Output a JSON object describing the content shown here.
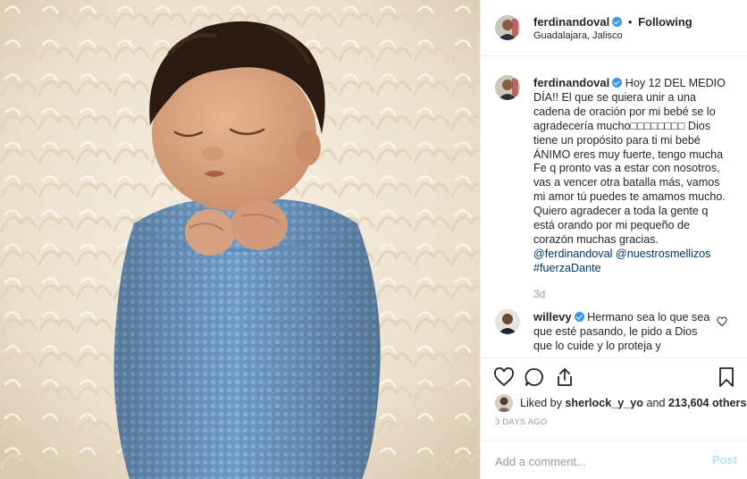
{
  "post": {
    "author": "ferdinandoval",
    "follow_status": "Following",
    "separator": "•",
    "location": "Guadalajara, Jalisco"
  },
  "photo": {
    "subject": "newborn baby wrapped in blue knit blanket on cream fur"
  },
  "caption": {
    "username": "ferdinandoval",
    "text": "Hoy 12 DEL MEDIO DÍA!! El que se quiera unir a una cadena de oración por mi bebé se lo agradecería mucho□□□□□□□□ Dios tiene un propósito para ti mi bebé ÁNIMO eres muy fuerte, tengo mucha Fe q pronto vas a estar con nosotros, vas a vencer otra batalla más, vamos mi amor tú puedes te amamos mucho. Quiero agradecer a toda la gente q está orando por mi pequeño de corazón muchas gracias.",
    "mention_1": "@ferdinandoval",
    "mention_2": "@nuestrosmellizos",
    "hashtag": "#fuerzaDante",
    "timestamp": "3d"
  },
  "comments": [
    {
      "username": "willevy",
      "text": "Hermano sea lo que sea que esté pasando, le pido a Dios que lo cuide y lo proteja y"
    }
  ],
  "likes": {
    "prefix": "Liked by",
    "liker": "sherlock_y_yo",
    "middle": "and",
    "count": "213,604 others"
  },
  "time_ago": "3 DAYS AGO",
  "add_comment": {
    "placeholder": "Add a comment...",
    "post_label": "Post"
  },
  "icons": {
    "like": "heart-icon",
    "comment": "comment-bubble-icon",
    "share": "share-icon",
    "save": "bookmark-icon",
    "verified": "verified-badge-icon"
  },
  "colors": {
    "accent": "#3897f0",
    "link": "#003569",
    "muted": "#999999",
    "post_disabled": "#b2dffc",
    "blanket": "#6d9ac5"
  }
}
